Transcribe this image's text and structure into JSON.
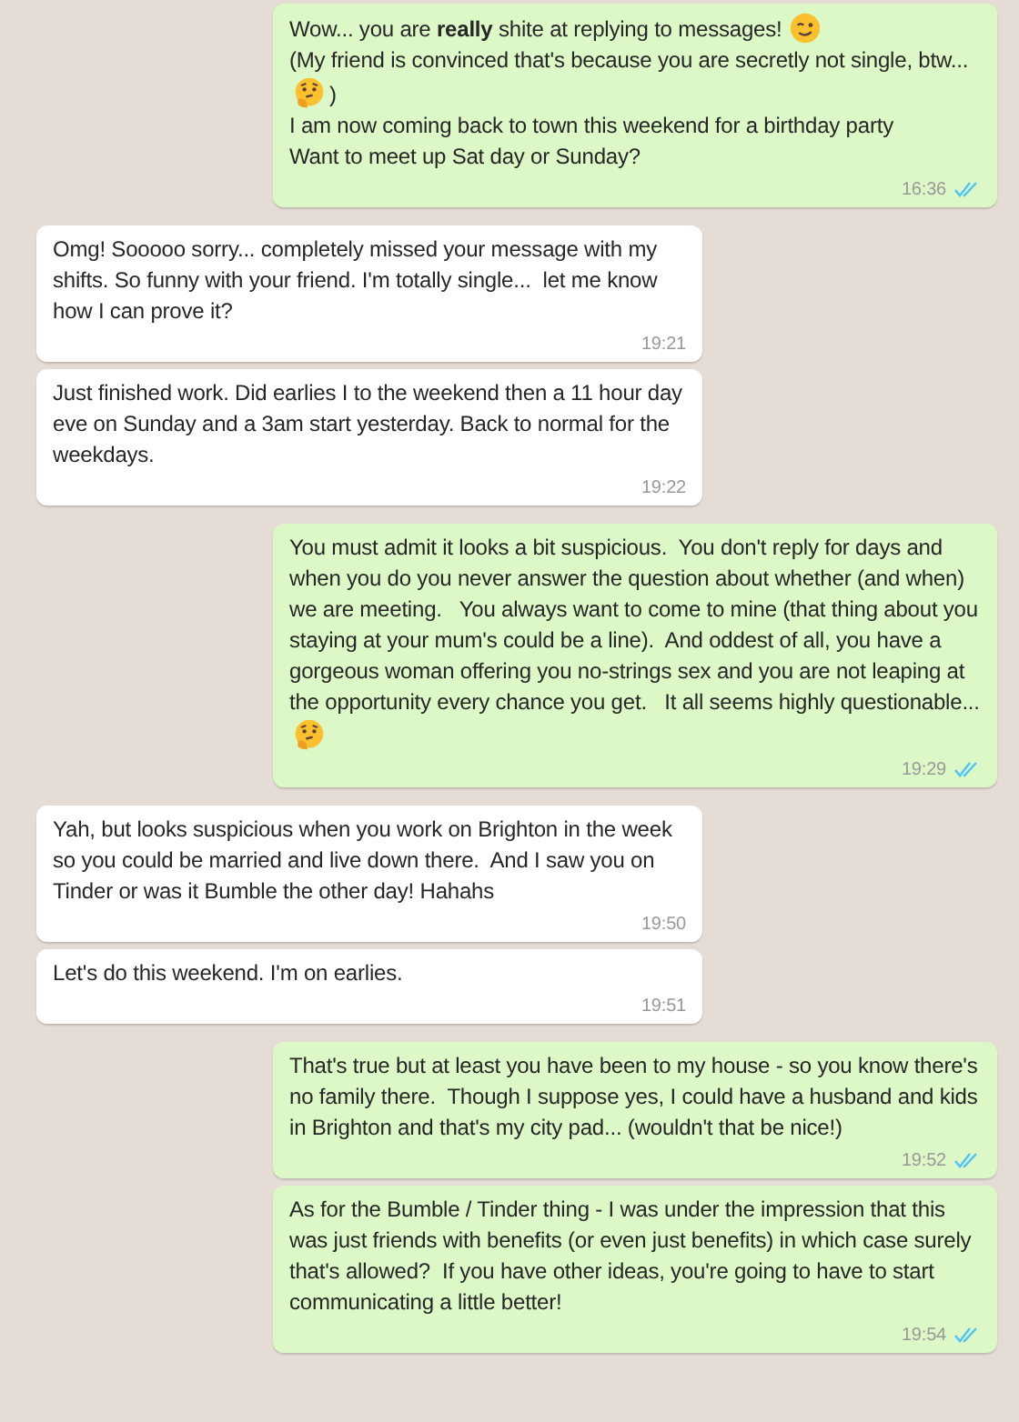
{
  "messages": [
    {
      "kind": "outgoing",
      "paragraphs": [
        [
          {
            "kind": "text",
            "text": "Wow... you are **really** shite at replying to messages!"
          },
          {
            "kind": "wink"
          }
        ],
        [
          {
            "kind": "text",
            "text": "(My friend is convinced that's because you are secretly not single, btw..."
          },
          {
            "kind": "thinking"
          },
          {
            "kind": "text",
            "text": ")"
          }
        ],
        [
          {
            "kind": "text",
            "text": "I am now coming back to town this weekend for a birthday party                         Want to meet up Sat day or Sunday?"
          }
        ]
      ],
      "time": "16:36",
      "read": true
    },
    {
      "kind": "incoming",
      "paragraphs": [
        [
          {
            "kind": "text",
            "text": "Omg! Sooooo sorry... completely missed your message with my shifts. So funny with your friend. I'm totally single...  let me know how I can prove it?"
          }
        ]
      ],
      "time": "19:21"
    },
    {
      "kind": "incoming",
      "paragraphs": [
        [
          {
            "kind": "text",
            "text": "Just finished work. Did earlies I to the weekend then a 11 hour day eve on Sunday and a 3am start yesterday. Back to normal for the weekdays."
          }
        ]
      ],
      "time": "19:22"
    },
    {
      "kind": "outgoing",
      "paragraphs": [
        [
          {
            "kind": "text",
            "text": "You must admit it looks a bit suspicious.  You don't reply for days and when you do you never answer the question about whether (and when) we are meeting.   You always want to come to mine (that thing about you staying at your mum's could be a line).  And oddest of all, you have a gorgeous woman offering you no-strings sex and you are not leaping at the opportunity every chance you get.   It all seems highly questionable..."
          },
          {
            "kind": "thinking"
          }
        ]
      ],
      "time": "19:29",
      "read": true
    },
    {
      "kind": "incoming",
      "paragraphs": [
        [
          {
            "kind": "text",
            "text": "Yah, but looks suspicious when you work on Brighton in the week so you could be married and live down there.  And I saw you on Tinder or was it Bumble the other day! Hahahs"
          }
        ]
      ],
      "time": "19:50"
    },
    {
      "kind": "incoming",
      "paragraphs": [
        [
          {
            "kind": "text",
            "text": "Let's do this weekend. I'm on earlies."
          }
        ]
      ],
      "time": "19:51"
    },
    {
      "kind": "outgoing",
      "paragraphs": [
        [
          {
            "kind": "text",
            "text": "That's true but at least you have been to my house - so you know there's no family there.  Though I suppose yes, I could have a husband and kids in Brighton and that's my city pad... (wouldn't that be nice!)"
          }
        ]
      ],
      "time": "19:52",
      "read": true
    },
    {
      "kind": "outgoing",
      "paragraphs": [
        [
          {
            "kind": "text",
            "text": "As for the Bumble / Tinder thing - I was under the impression that this was just friends with benefits (or even just benefits) in which case surely that's allowed?  If you have other ideas, you're going to have to start communicating a little better!"
          }
        ]
      ],
      "time": "19:54",
      "read": true
    }
  ]
}
